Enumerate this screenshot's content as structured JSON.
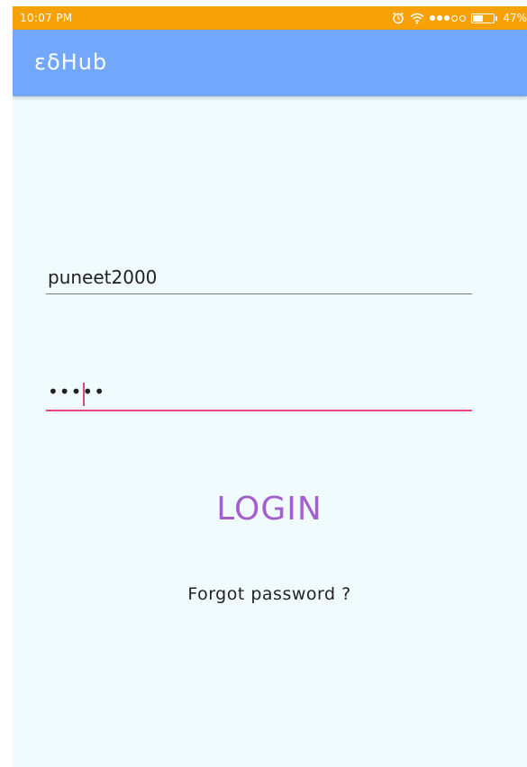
{
  "status_bar": {
    "time": "10:07 PM",
    "battery_percent": "47%",
    "battery_level": 0.47,
    "icons": [
      "alarm-icon",
      "wifi-icon",
      "signal-icon",
      "battery-icon"
    ]
  },
  "app_bar": {
    "title": "εδHub",
    "color": "#73a7fb"
  },
  "login_form": {
    "username_value": "puneet2000",
    "password_value": "•••••",
    "login_label": "LOGIN",
    "forgot_label": "Forgot password ?"
  },
  "colors": {
    "status_bar": "#f7a108",
    "background": "#f0fbfd",
    "accent": "#e2457a",
    "login_text": "#a45fcf"
  }
}
